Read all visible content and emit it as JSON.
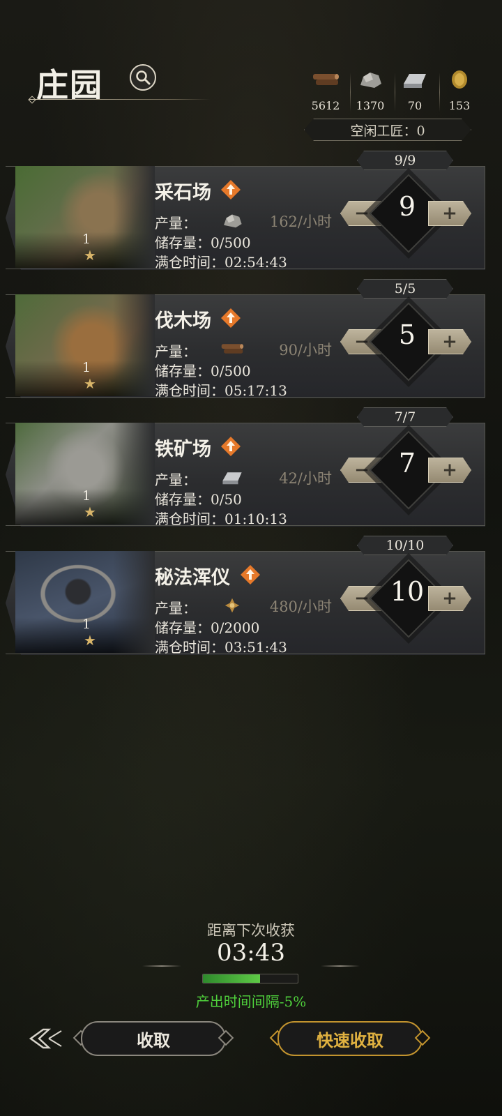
{
  "header": {
    "title": "庄园",
    "search_icon": "search-icon",
    "resources": [
      {
        "icon": "wood-icon",
        "value": "5612"
      },
      {
        "icon": "stone-icon",
        "value": "1370"
      },
      {
        "icon": "iron-icon",
        "value": "70"
      },
      {
        "icon": "gold-coin-icon",
        "value": "153"
      }
    ],
    "idle_workers": "空闲工匠：0"
  },
  "buildings": [
    {
      "name": "采石场",
      "capacity": "9/9",
      "level": "1",
      "prod_label": "产量：",
      "prod_icon": "stone-icon",
      "rate": "162/小时",
      "storage": "储存量：0/500",
      "full_time": "满仓时间：02:54:43",
      "workers": "9"
    },
    {
      "name": "伐木场",
      "capacity": "5/5",
      "level": "1",
      "prod_label": "产量：",
      "prod_icon": "wood-icon",
      "rate": "90/小时",
      "storage": "储存量：0/500",
      "full_time": "满仓时间：05:17:13",
      "workers": "5"
    },
    {
      "name": "铁矿场",
      "capacity": "7/7",
      "level": "1",
      "prod_label": "产量：",
      "prod_icon": "iron-icon",
      "rate": "42/小时",
      "storage": "储存量：0/50",
      "full_time": "满仓时间：01:10:13",
      "workers": "7"
    },
    {
      "name": "秘法浑仪",
      "capacity": "10/10",
      "level": "1",
      "prod_label": "产量：",
      "prod_icon": "arcane-crystal-icon",
      "rate": "480/小时",
      "storage": "储存量：0/2000",
      "full_time": "满仓时间：03:51:43",
      "workers": "10"
    }
  ],
  "footer": {
    "next_harvest_label": "距离下次收获",
    "next_harvest_timer": "03:43",
    "progress": 0.6,
    "interval_text": "产出时间间隔-5%",
    "collect_label": "收取",
    "quick_collect_label": "快速收取"
  },
  "colors": {
    "accent_gold": "#c2932e",
    "interval_green": "#4fd13c"
  }
}
